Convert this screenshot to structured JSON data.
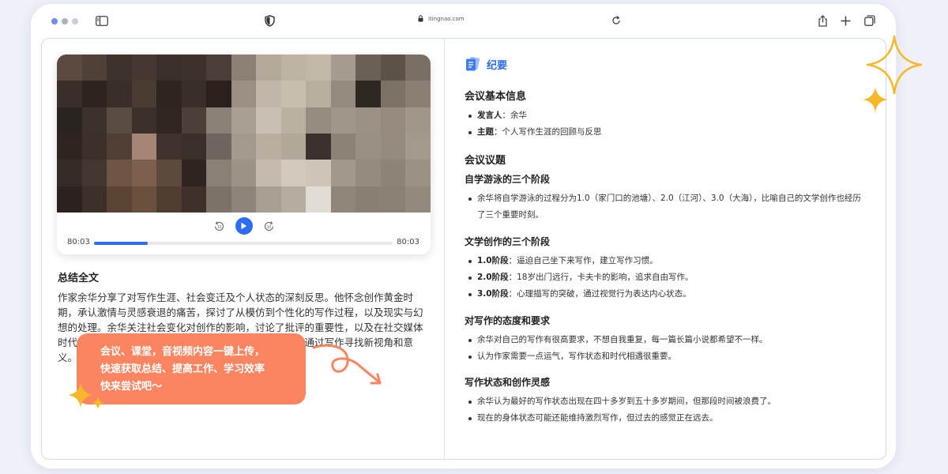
{
  "browser": {
    "url": "itingnao.com",
    "dot_colors": [
      "#6b8fe8",
      "#aab3c6",
      "#c9ced9"
    ]
  },
  "player": {
    "time_current": "80:03",
    "time_total": "80:03",
    "progress": 0.18,
    "rewind_label": "10",
    "forward_label": "10"
  },
  "summary": {
    "title": "总结全文",
    "text": "作家余华分享了对写作生涯、社会变迁及个人状态的深刻反思。他怀念创作黄金时期，承认激情与灵感衰退的痛苦，探讨了从模仿到个性化的写作过程，以及现实与幻想的处理。余华关注社会变化对创作的影响，讨论了批评的重要性，以及在社交媒体时代保持创作执着的意义。他表示将继续以开放的心态，通过写作寻找新视角和意义。"
  },
  "promo": {
    "line1": "会议、课堂，音视频内容一键上传，",
    "line2": "快速获取总结、提高工作、学习效率",
    "line3": "快来尝试吧～"
  },
  "minutes": {
    "title": "纪要",
    "basic_info": {
      "heading": "会议基本信息",
      "items": [
        {
          "label": "发言人",
          "value": "：余华"
        },
        {
          "label": "主题",
          "value": "：个人写作生涯的回顾与反思"
        }
      ]
    },
    "topics_heading": "会议议题",
    "sections": [
      {
        "heading": "自学游泳的三个阶段",
        "items": [
          {
            "label": "",
            "value": "余华将自学游泳的过程分为1.0（家门口的池塘）、2.0（江河）、3.0（大海），比喻自己的文学创作也经历了三个重要时刻。"
          }
        ]
      },
      {
        "heading": "文学创作的三个阶段",
        "items": [
          {
            "label": "1.0阶段",
            "value": "：逼迫自己坐下来写作，建立写作习惯。"
          },
          {
            "label": "2.0阶段",
            "value": "：18岁出门远行，卡夫卡的影响，追求自由写作。"
          },
          {
            "label": "3.0阶段",
            "value": "：心理描写的突破，通过视觉行为表达内心状态。"
          }
        ]
      },
      {
        "heading": "对写作的态度和要求",
        "items": [
          {
            "label": "",
            "value": "余华对自己的写作有很高要求，不想自我重复，每一篇长篇小说都希望不一样。"
          },
          {
            "label": "",
            "value": "认为作家需要一点运气，写作状态和时代相遇很重要。"
          }
        ]
      },
      {
        "heading": "写作状态和创作灵感",
        "items": [
          {
            "label": "",
            "value": "余华认为最好的写作状态出现在四十多岁到五十多岁期间，但那段时间被浪费了。"
          },
          {
            "label": "",
            "value": "现在的身体状态可能还能维持激烈写作，但过去的感觉正在远去。"
          }
        ]
      }
    ]
  },
  "colors": {
    "accent": "#2d6cf3",
    "promo_bg": "#fb8561",
    "sparkle": "#f6b82b"
  }
}
